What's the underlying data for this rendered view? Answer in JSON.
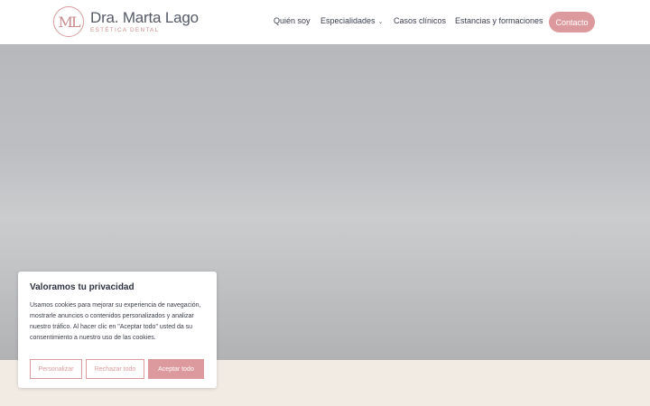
{
  "header": {
    "logo_mark": "ML",
    "logo_name": "Dra. Marta Lago",
    "logo_subtitle": "ESTÉTICA DENTAL",
    "nav": [
      {
        "label": "Quién soy"
      },
      {
        "label": "Especialidades",
        "has_dropdown": true
      },
      {
        "label": "Casos clínicos"
      },
      {
        "label": "Estancias y formaciones"
      }
    ],
    "contact_label": "Contacto"
  },
  "cookie_banner": {
    "title": "Valoramos tu privacidad",
    "text": "Usamos cookies para mejorar su experiencia de navegación, mostrarle anuncios o contenidos personalizados y analizar nuestro tráfico. Al hacer clic en \"Aceptar todo\" usted da su consentimiento a nuestro uso de las cookies.",
    "buttons": {
      "customize": "Personalizar",
      "reject": "Rechazar todo",
      "accept": "Aceptar todo"
    }
  },
  "colors": {
    "accent": "#dd9a9e",
    "text": "#3d4150",
    "footer_band": "#f1ebe4"
  }
}
